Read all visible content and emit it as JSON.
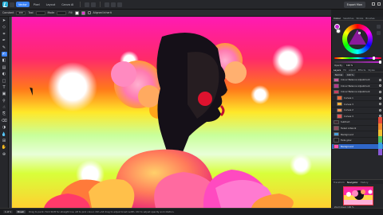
{
  "app": {
    "personas": [
      "Vector",
      "Pixel",
      "Layout",
      "Canva AI"
    ],
    "export_label": "Export Mon",
    "colors": {
      "accent": "#3b82f6",
      "background": "#1e1f22",
      "panel": "#26272b"
    }
  },
  "context": {
    "label_1": "Constant",
    "field_1": "100",
    "label_2": "Tool",
    "label_3": "Mode",
    "label_4": "Fill",
    "option": "Aligned Inherit"
  },
  "tools": [
    "move-tool",
    "node-tool",
    "crop-tool",
    "pen-tool",
    "pencil-tool",
    "brush-tool",
    "fill-tool",
    "gradient-tool",
    "transparency-tool",
    "shape-tool",
    "text-tool",
    "frame-tool",
    "eyedropper-tool",
    "smudge-tool",
    "clone-tool",
    "eraser-tool",
    "dodge-tool",
    "blur-tool",
    "mesh-tool",
    "hand-tool",
    "zoom-tool"
  ],
  "panels": {
    "color_tabs": [
      "Colour",
      "Swatches",
      "Stroke",
      "Brushes"
    ],
    "opacity_label": "Opacity",
    "opacity_value": "100 %",
    "layer_tabs": [
      "Layers",
      "Fill",
      "Adjust",
      "Effects",
      "Styles"
    ],
    "layer_controls": [
      "Normal",
      "100 %"
    ],
    "layers": [
      {
        "name": "Colour Balance Adjustment",
        "thumb": "#c85a9e",
        "selected": false,
        "indent": false
      },
      {
        "name": "Colour Balance Adjustment",
        "thumb": "#b13a8a",
        "selected": false,
        "indent": false
      },
      {
        "name": "Colour Balance Adjustment",
        "thumb": "#c84060",
        "selected": false,
        "indent": false
      },
      {
        "name": "Curves 1",
        "thumb": "#e86a3a",
        "selected": false,
        "indent": true
      },
      {
        "name": "Curves 3",
        "thumb": "#f4b03a",
        "selected": false,
        "indent": true
      },
      {
        "name": "Curves 2",
        "thumb": "#f08a55",
        "selected": false,
        "indent": true
      },
      {
        "name": "Curves 3",
        "thumb": "#e05858",
        "selected": false,
        "indent": true
      },
      {
        "name": "Subtract",
        "thumb": "#3d2a30",
        "selected": false,
        "indent": false
      },
      {
        "name": "Faded Artwork",
        "thumb": "#8a4a5a",
        "selected": false,
        "indent": false
      },
      {
        "name": "Background",
        "thumb": "#4a9dd8",
        "selected": false,
        "indent": false
      },
      {
        "name": "Fade glow",
        "thumb": "#222",
        "selected": false,
        "indent": false
      },
      {
        "name": "Background",
        "thumb": "#ff4fb0",
        "selected": true,
        "indent": false
      }
    ],
    "nav_tabs": [
      "Transform",
      "Navigator",
      "History"
    ],
    "zoom": "Zoom level: 100 %"
  },
  "status": {
    "page": "1 of 1",
    "mode": "Brush",
    "hint": "Drag to paint. Hold Shift for straight line. Alt to pick colour. Ctrl+Alt drag to adjust brush width. Ctrl to adjust opacity and rotation."
  }
}
